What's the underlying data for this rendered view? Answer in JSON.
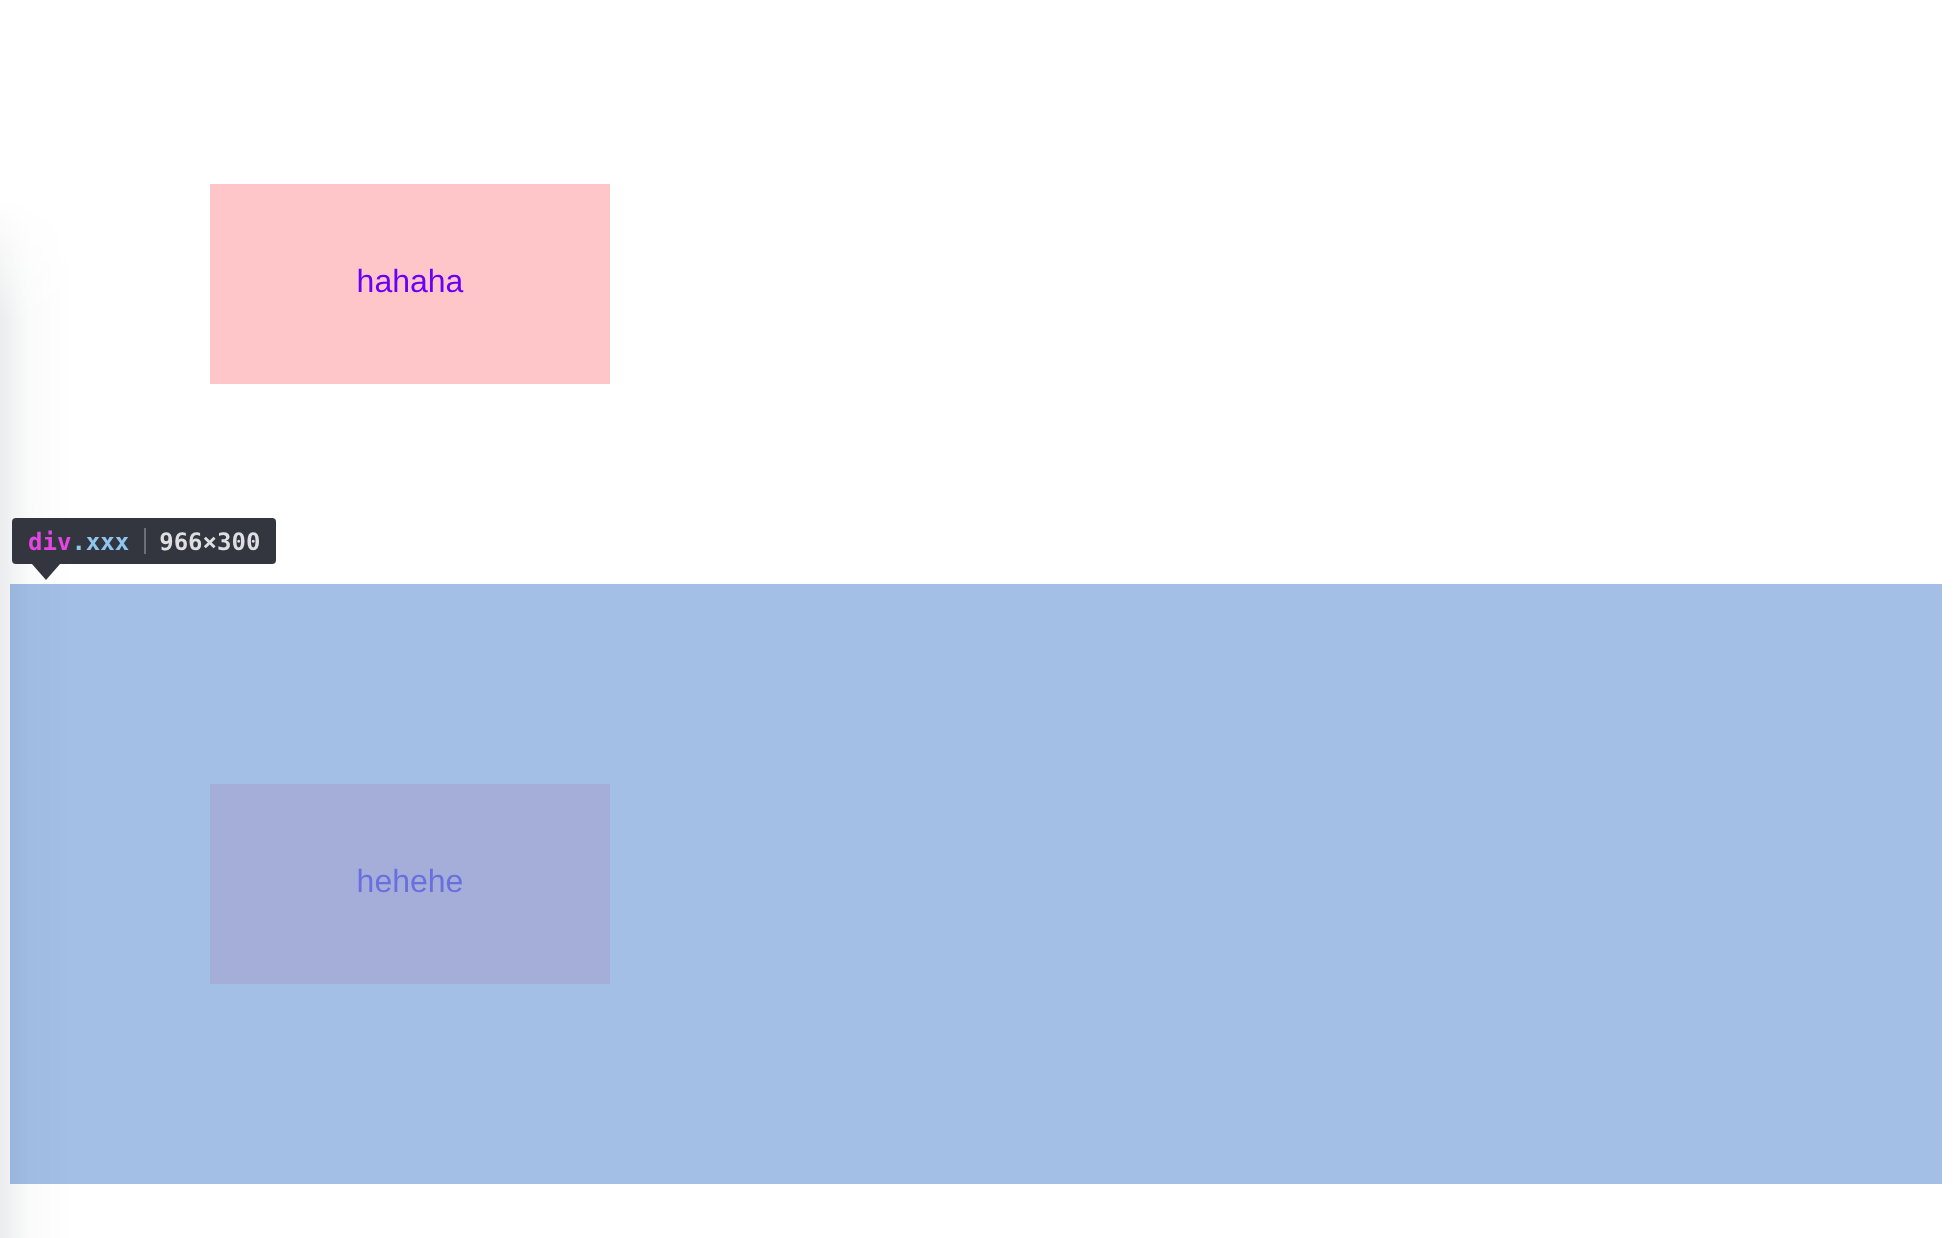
{
  "sections": [
    {
      "highlighted": false,
      "box": "hahaha"
    },
    {
      "highlighted": true,
      "box": "hehehe"
    }
  ],
  "inspector_tooltip": {
    "tag": "div",
    "class": ".xxx",
    "size": "966×300"
  }
}
